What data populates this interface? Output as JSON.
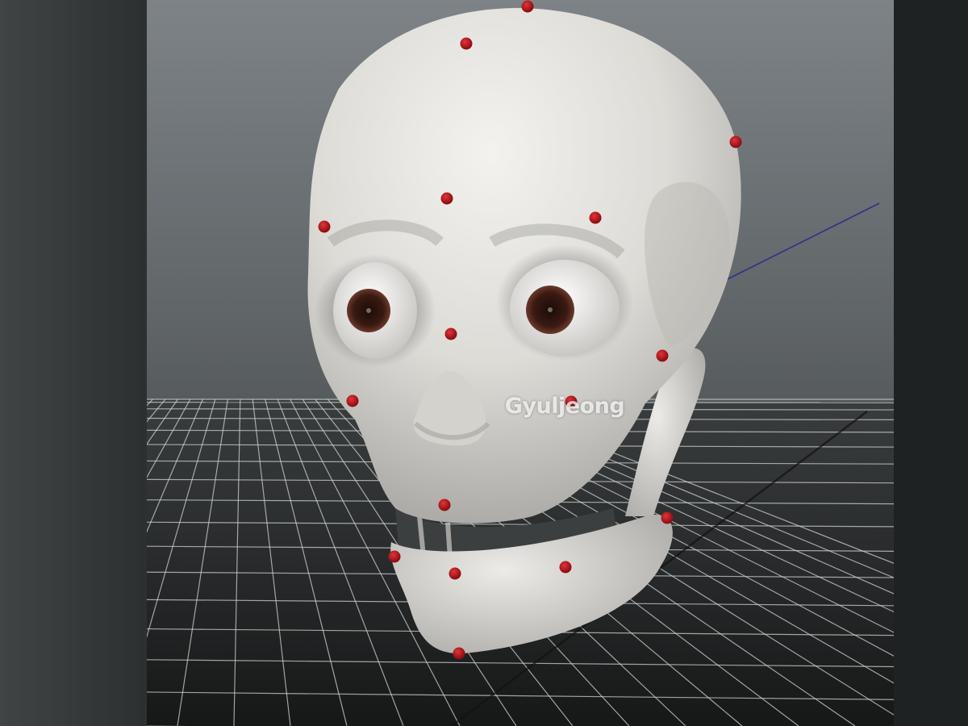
{
  "photo": {
    "subject_icon": "skull-icon",
    "colors": {
      "skull": "#e6e4e0",
      "marker": "#b3141a",
      "viewport_bg": "#5c6163",
      "grid_line": "#d0d2d2",
      "left_frame": "#3b3e3e",
      "right_frame": "#1f2222"
    }
  },
  "watermark": {
    "text": "Gyuljeong"
  }
}
